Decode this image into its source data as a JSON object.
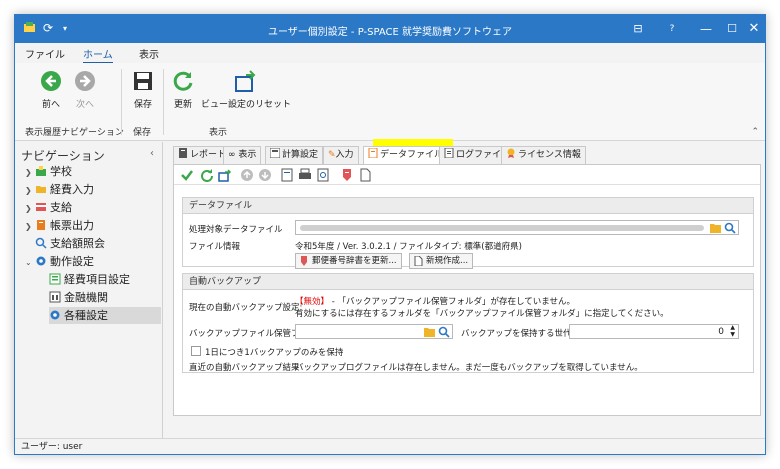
{
  "window": {
    "title": "ユーザー個別設定 - P-SPACE 就学奨励費ソフトウェア"
  },
  "ribbon_tabs": [
    "ファイル",
    "ホーム",
    "表示"
  ],
  "ribbon": {
    "back": "前へ",
    "forward": "次へ",
    "history_group": "表示履歴ナビゲーション",
    "save": "保存",
    "save_group": "保存",
    "refresh": "更新",
    "view_reset": "ビュー設定のリセット",
    "view_group": "表示"
  },
  "nav": {
    "title": "ナビゲーション",
    "items": [
      "学校",
      "経費入力",
      "支給",
      "帳票出力",
      "支給額照会",
      "動作設定"
    ],
    "sub_items": [
      "経費項目設定",
      "金融機関",
      "各種設定"
    ]
  },
  "tabs": [
    "レポート",
    "表示",
    "計算設定",
    "入力",
    "データファイル",
    "ログファイル",
    "ライセンス情報"
  ],
  "data_file": {
    "section": "データファイル",
    "target_label": "処理対象データファイル",
    "info_label": "ファイル情報",
    "info_value": "令和5年度 / Ver. 3.0.2.1 / ファイルタイプ: 標準(都道府県)",
    "update_postal": "郵便番号辞書を更新...",
    "new_file": "新規作成..."
  },
  "backup": {
    "section": "自動バックアップ",
    "current_label": "現在の自動バックアップ設定:",
    "disabled": "【無効】",
    "current_msg": " - 「バックアップファイル保管フォルダ」が存在していません。",
    "current_msg2": "有効にするには存在するフォルダを「バックアップファイル保管フォルダ」に指定してください。",
    "folder_label": "バックアップファイル保管フォルダ",
    "generations_label": "バックアップを保持する世代数",
    "generations_value": "0",
    "once_per_day": "1日につき1バックアップのみを保持",
    "recent_label": "直近の自動バックアップ結果",
    "recent_value": "バックアップログファイルは存在しません。まだ一度もバックアップを取得していません。"
  },
  "status": {
    "user": "ユーザー: user"
  }
}
